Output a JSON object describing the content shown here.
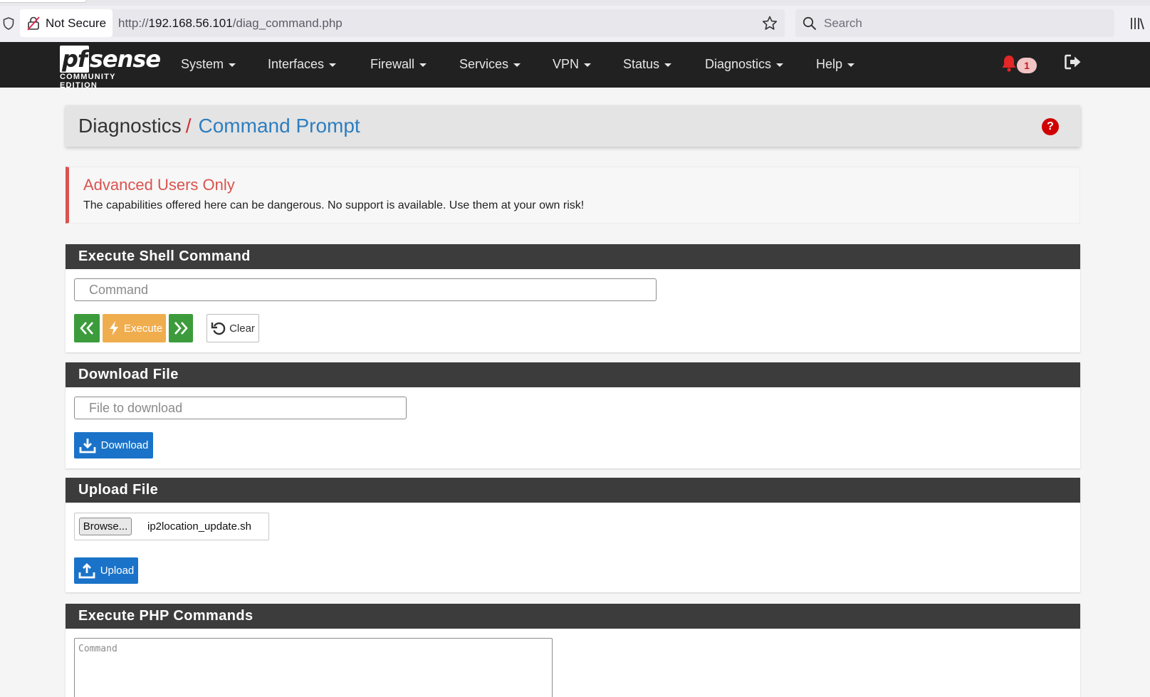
{
  "browser": {
    "not_secure_label": "Not Secure",
    "url_prefix": "http://",
    "url_host": "192.168.56.101",
    "url_path": "/diag_command.php",
    "search_placeholder": "Search"
  },
  "navbar": {
    "brand_logo_pf": "pf",
    "brand_logo_sense": "sense",
    "brand_edition": "COMMUNITY EDITION",
    "items": [
      {
        "label": "System"
      },
      {
        "label": "Interfaces"
      },
      {
        "label": "Firewall"
      },
      {
        "label": "Services"
      },
      {
        "label": "VPN"
      },
      {
        "label": "Status"
      },
      {
        "label": "Diagnostics"
      },
      {
        "label": "Help"
      }
    ],
    "notification_count": "1"
  },
  "breadcrumb": {
    "parent": "Diagnostics",
    "separator": "/",
    "current": "Command Prompt",
    "help_label": "?"
  },
  "alert": {
    "title": "Advanced Users Only",
    "text": "The capabilities offered here can be dangerous. No support is available. Use them at your own risk!"
  },
  "shell": {
    "title": "Execute Shell Command",
    "command_placeholder": "Command",
    "execute_label": "Execute",
    "clear_label": "Clear"
  },
  "download": {
    "title": "Download File",
    "file_placeholder": "File to download",
    "button_label": "Download"
  },
  "upload": {
    "title": "Upload File",
    "browse_label": "Browse...",
    "selected_file": "ip2location_update.sh",
    "button_label": "Upload"
  },
  "php": {
    "title": "Execute PHP Commands",
    "command_placeholder": "Command"
  },
  "colors": {
    "navbar_bg": "#212121",
    "panel_header_bg": "#3c3c3c",
    "alert_red": "#d9534f",
    "link_blue": "#2d7ec0",
    "success_green": "#3c9c3c",
    "warning_orange": "#f0ad4e",
    "primary_blue": "#1a73c8"
  }
}
